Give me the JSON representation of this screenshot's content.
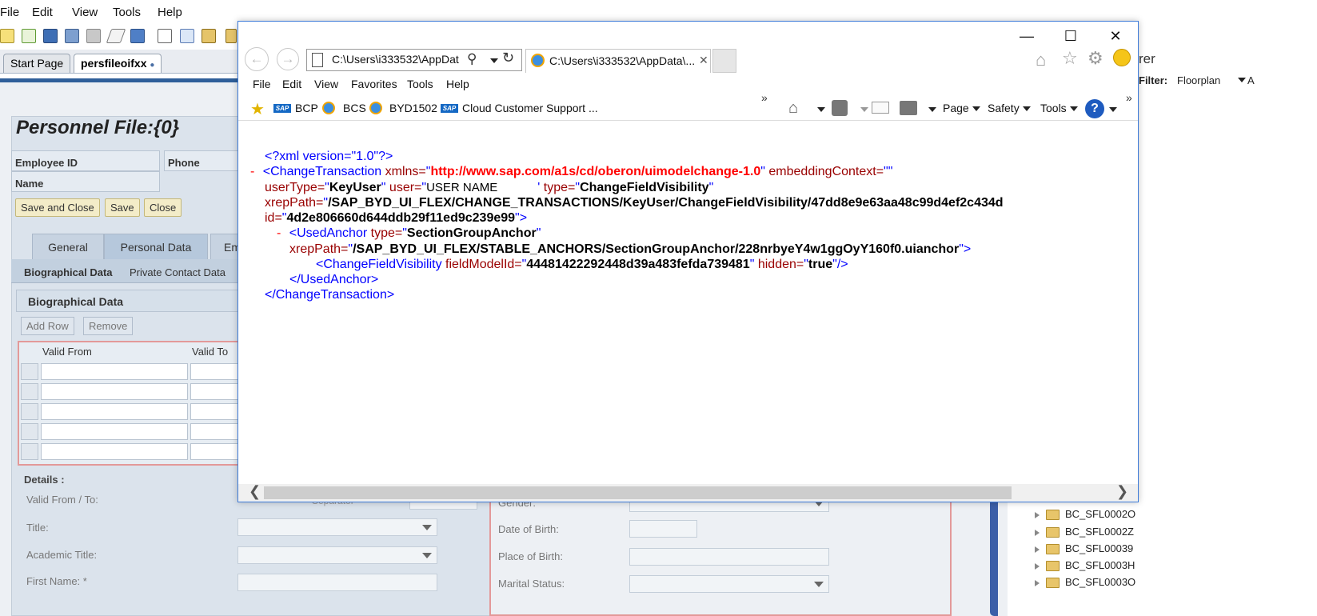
{
  "app": {
    "menu": [
      "File",
      "Edit",
      "View",
      "Tools",
      "Help"
    ],
    "doc_tabs": [
      "Start Page",
      "persfileoifxx"
    ],
    "form": {
      "title": "Personnel File:{0}",
      "header_fields": [
        "Employee ID",
        "Phone",
        "Name"
      ],
      "buttons": [
        "Save and Close",
        "Save",
        "Close"
      ],
      "tabs": [
        "General",
        "Personal Data",
        "Em"
      ],
      "subtabs": [
        "Biographical Data",
        "Private Contact Data"
      ],
      "section": "Biographical Data",
      "table_buttons": [
        "Add Row",
        "Remove"
      ],
      "columns": [
        "Valid From",
        "Valid To"
      ],
      "details_head": "Details :",
      "details_left": [
        "Valid From / To:",
        "Title:",
        "Academic Title:",
        "First Name: *"
      ],
      "separator": "Separator",
      "details_right": [
        "Gender:",
        "Date of Birth:",
        "Place of Birth:",
        "Marital Status:"
      ]
    },
    "explorer": {
      "title_fragment": "rer",
      "filter_label": "Filter:",
      "filter_value": "Floorplan",
      "filter_extra": "A",
      "tree": [
        "BC_SFL0002O",
        "BC_SFL0002Z",
        "BC_SFL00039",
        "BC_SFL0003H",
        "BC_SFL0003O"
      ]
    }
  },
  "browser": {
    "address": "C:\\Users\\i333532\\AppDat",
    "tab_title": "C:\\Users\\i333532\\AppData\\...",
    "menu": [
      "File",
      "Edit",
      "View",
      "Favorites",
      "Tools",
      "Help"
    ],
    "favorites": [
      "BCP",
      "BCS",
      "BYD1502",
      "Cloud Customer Support ..."
    ],
    "commands": [
      "Page",
      "Safety",
      "Tools"
    ],
    "chevron": "»"
  },
  "xml": {
    "decl": "<?xml version=\"1.0\"?>",
    "minus": "-",
    "ct_open": "<ChangeTransaction",
    "xmlns_attr": "xmlns=",
    "xmlns_val": "http://www.sap.com/a1s/cd/oberon/uimodelchange-1.0",
    "embedding_attr": "embeddingContext=",
    "embedding_val": "\"\"",
    "usertype_attr": "userType=",
    "usertype_val": "KeyUser",
    "user_attr": "user=",
    "user_val": "USER NAME",
    "type_attr": "type=",
    "type_val": "ChangeFieldVisibility",
    "xrep_attr": "xrepPath=",
    "xrep_val": "/SAP_BYD_UI_FLEX/CHANGE_TRANSACTIONS/KeyUser/ChangeFieldVisibility/47dd8e9e63aa48c99d4ef2c434d",
    "id_attr": "id=",
    "id_val": "4d2e806660d644ddb29f11ed9c239e99",
    "ua_open": "<UsedAnchor",
    "ua_type_val": "SectionGroupAnchor",
    "ua_xrep_val": "/SAP_BYD_UI_FLEX/STABLE_ANCHORS/SectionGroupAnchor/228nrbyeY4w1ggOyY160f0.uianchor",
    "cfv_open": "<ChangeFieldVisibility",
    "field_attr": "fieldModelId=",
    "field_val": "44481422292448d39a483fefda739481",
    "hidden_attr": "hidden=",
    "hidden_val": "true",
    "ua_close": "</UsedAnchor>",
    "ct_close": "</ChangeTransaction>"
  }
}
